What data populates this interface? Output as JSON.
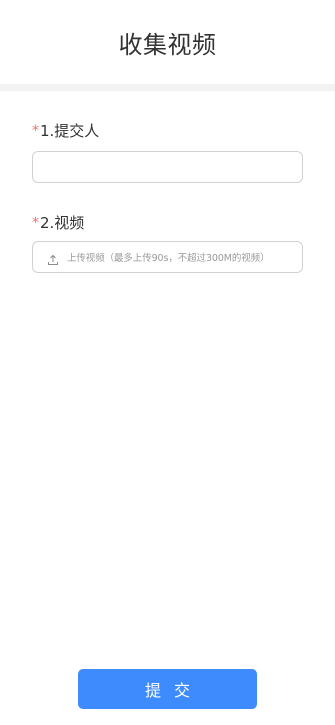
{
  "header": {
    "title": "收集视频"
  },
  "form": {
    "fields": [
      {
        "required_mark": "*",
        "label": "1.提交人",
        "value": ""
      },
      {
        "required_mark": "*",
        "label": "2.视频",
        "upload_icon": "upload-icon",
        "upload_hint": "上传视频（最多上传90s，不超过300M的视频）"
      }
    ]
  },
  "footer": {
    "submit_label": "提 交"
  },
  "colors": {
    "accent": "#3d8bfd",
    "required": "#f56c6c",
    "separator": "#f2f2f2",
    "border": "#d2d2d2"
  }
}
